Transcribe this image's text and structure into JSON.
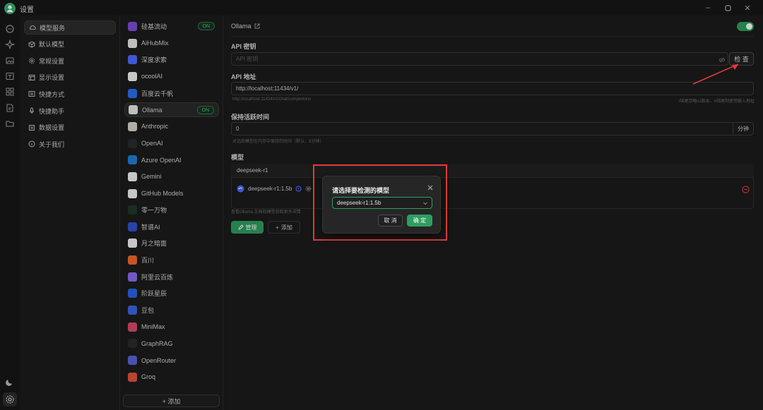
{
  "window": {
    "title": "设置"
  },
  "colors": {
    "accent": "#2e9e5f",
    "annotation": "#e23a3a",
    "background": "#1b1b1b"
  },
  "nav": {
    "items": [
      {
        "label": "模型服务",
        "icon": "cloud-icon",
        "active": true
      },
      {
        "label": "默认模型",
        "icon": "cube-icon"
      },
      {
        "label": "常规设置",
        "icon": "gear-icon"
      },
      {
        "label": "显示设置",
        "icon": "monitor-icon"
      },
      {
        "label": "快捷方式",
        "icon": "keyboard-icon"
      },
      {
        "label": "快捷助手",
        "icon": "mic-icon"
      },
      {
        "label": "数据设置",
        "icon": "database-icon"
      },
      {
        "label": "关于我们",
        "icon": "info-icon"
      }
    ]
  },
  "providers": {
    "items": [
      {
        "label": "硅基流动",
        "badge": "ON",
        "logo": "#7a4fd6",
        "glyph": ""
      },
      {
        "label": "AiHubMix",
        "logo": "#e8e8e8",
        "glyph": ""
      },
      {
        "label": "深度求索",
        "logo": "#4d6bfe",
        "glyph": ""
      },
      {
        "label": "ocoolAI",
        "logo": "#f2f2f2",
        "glyph": ""
      },
      {
        "label": "百度云千帆",
        "logo": "#2a6ff0",
        "glyph": ""
      },
      {
        "label": "Ollama",
        "badge": "ON",
        "logo": "#e8e8e8",
        "glyph": "",
        "active": true
      },
      {
        "label": "Anthropic",
        "logo": "#d8d3c8",
        "glyph": ""
      },
      {
        "label": "OpenAI",
        "logo": "#2b2b2b",
        "glyph": ""
      },
      {
        "label": "Azure OpenAI",
        "logo": "#1f7fd6",
        "glyph": ""
      },
      {
        "label": "Gemini",
        "logo": "#f2f2f2",
        "glyph": ""
      },
      {
        "label": "GitHub Models",
        "logo": "#f2f2f2",
        "glyph": ""
      },
      {
        "label": "零一万物",
        "logo": "#1e3a2a",
        "glyph": ""
      },
      {
        "label": "智谱AI",
        "logo": "#3451d1",
        "glyph": ""
      },
      {
        "label": "月之暗面",
        "logo": "#f2f2f2",
        "glyph": ""
      },
      {
        "label": "百川",
        "logo": "#f06a2a",
        "glyph": ""
      },
      {
        "label": "阿里云百炼",
        "logo": "#8a6cf0",
        "glyph": ""
      },
      {
        "label": "阶跃星辰",
        "logo": "#2a63e6",
        "glyph": ""
      },
      {
        "label": "豆包",
        "logo": "#3a66e0",
        "glyph": ""
      },
      {
        "label": "MiniMax",
        "logo": "#d84a6a",
        "glyph": ""
      },
      {
        "label": "GraphRAG",
        "logo": "#2b2b2b",
        "glyph": ""
      },
      {
        "label": "OpenRouter",
        "logo": "#5865d6",
        "glyph": ""
      },
      {
        "label": "Groq",
        "logo": "#e2533a",
        "glyph": ""
      }
    ],
    "add_label": "+ 添加"
  },
  "main": {
    "provider_name": "Ollama",
    "enabled": true,
    "api_key": {
      "label": "API 密钥",
      "placeholder": "API 密钥",
      "check_label": "检 查"
    },
    "api_host": {
      "label": "API 地址",
      "value": "http://localhost:11434/v1/",
      "preview": "http://localhost:11434/v1/chat/completions",
      "hint": "/结尾忽略v1版本，#结尾制使用输入地址"
    },
    "keep_alive": {
      "label": "保持活跃时间",
      "value": "0",
      "unit": "分钟",
      "hint": "对话后模型在内存中保持的时间（默认：5分钟）"
    },
    "models": {
      "label": "模型",
      "group": "deepseek-r1",
      "items": [
        {
          "name": "deepseek-r1:1.5b"
        }
      ],
      "doc_hint": "查看Ollama 文档和模型获取更多详情"
    },
    "manage_label": "管理",
    "add_label": "添加"
  },
  "dialog": {
    "title": "请选择要检测的模型",
    "selected": "deepseek-r1:1.5b",
    "cancel": "取 消",
    "ok": "确 定"
  }
}
